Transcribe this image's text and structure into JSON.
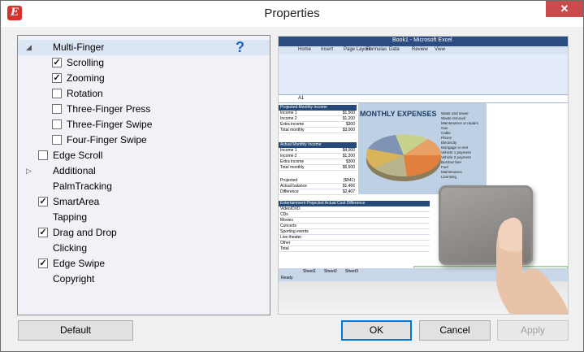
{
  "window": {
    "title": "Properties",
    "close_glyph": "✕",
    "app_icon_glyph": "E"
  },
  "tree": {
    "items": [
      {
        "label": "Multi-Finger",
        "expander": "◢",
        "checkbox": null,
        "selected": true,
        "has_help": true
      },
      {
        "label": "Scrolling",
        "checkbox": true
      },
      {
        "label": "Zooming",
        "checkbox": true
      },
      {
        "label": "Rotation",
        "checkbox": false
      },
      {
        "label": "Three-Finger Press",
        "checkbox": false
      },
      {
        "label": "Three-Finger Swipe",
        "checkbox": false
      },
      {
        "label": "Four-Finger Swipe",
        "checkbox": false
      },
      {
        "label": "Edge Scroll",
        "checkbox": false
      },
      {
        "label": "Additional",
        "expander": "▷",
        "checkbox": null
      },
      {
        "label": "PalmTracking",
        "checkbox": null
      },
      {
        "label": "SmartArea",
        "checkbox": true
      },
      {
        "label": "Tapping",
        "checkbox": null
      },
      {
        "label": "Drag and Drop",
        "checkbox": true
      },
      {
        "label": "Clicking",
        "checkbox": null
      },
      {
        "label": "Edge Swipe",
        "checkbox": true
      },
      {
        "label": "Copyright",
        "checkbox": null
      }
    ],
    "help_glyph": "?",
    "check_glyph": "✓"
  },
  "preview": {
    "excel_title": "Book1 - Microsoft Excel",
    "tabs": [
      "Home",
      "Insert",
      "Page Layout",
      "Formulas",
      "Data",
      "Review",
      "View"
    ],
    "name_box": "A1",
    "chart_title": "MONTHLY EXPENSES",
    "legend": [
      "Water and sewer",
      "Waste removal",
      "Maintenance or repairs",
      "Gas",
      "Cable",
      "Phone",
      "Electricity",
      "Mortgage or rent",
      "Vehicle 1 payment",
      "Vehicle 2 payment",
      "Bus/taxi fare",
      "Fuel",
      "Maintenance",
      "Licensing"
    ],
    "table1": {
      "header": "Projected Monthly Income",
      "rows": [
        [
          "Income 1",
          "$1,500"
        ],
        [
          "Income 2",
          "$1,200"
        ],
        [
          "Extra income",
          "$300"
        ],
        [
          "Total monthly",
          "$3,000"
        ]
      ]
    },
    "table2": {
      "header": "Actual Monthly Income",
      "rows": [
        [
          "Income 1",
          "$4,000"
        ],
        [
          "Income 2",
          "$1,200"
        ],
        [
          "Extra income",
          "$300"
        ],
        [
          "Total monthly",
          "$5,500"
        ]
      ]
    },
    "table3": {
      "rows": [
        [
          "Projected",
          "($841)"
        ],
        [
          "Actual balance",
          "$1,466"
        ],
        [
          "Difference",
          "$2,407"
        ]
      ]
    },
    "table4": {
      "header": "Entertainment   Projected   Actual Cost   Difference",
      "rows": [
        "Video/DVD",
        "CDs",
        "Movies",
        "Concerts",
        "Sporting events",
        "Live theater",
        "Other",
        "Total"
      ]
    },
    "sheet_tabs": [
      "Sheet1",
      "Sheet2",
      "Sheet3"
    ],
    "status": "Ready"
  },
  "buttons": {
    "default": "Default",
    "ok": "OK",
    "cancel": "Cancel",
    "apply": "Apply"
  }
}
